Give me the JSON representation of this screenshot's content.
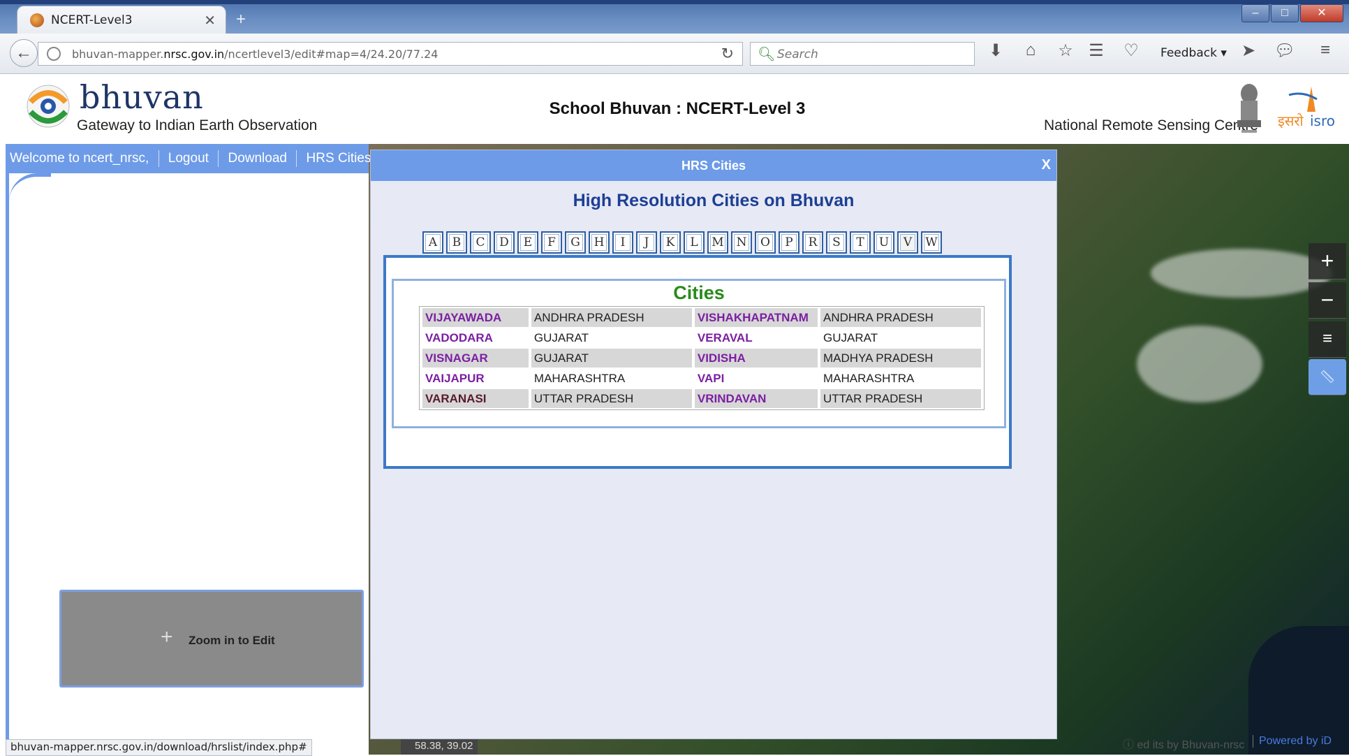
{
  "browser": {
    "tab_title": "NCERT-Level3",
    "tab_close": "✕",
    "new_tab": "+",
    "url_domain_prefix": "bhuvan-mapper.",
    "url_domain": "nrsc.gov.in",
    "url_path": "/ncertlevel3/edit#map=4/24.20/77.24",
    "search_placeholder": "Search",
    "feedback_label": "Feedback",
    "status_url": "bhuvan-mapper.nrsc.gov.in/download/hrslist/index.php#"
  },
  "header": {
    "logo_word": "bhuvan",
    "logo_tagline": "Gateway to Indian Earth Observation",
    "title": "School Bhuvan : NCERT-Level 3",
    "org": "National Remote Sensing Centre"
  },
  "menu": {
    "welcome": "Welcome to ncert_nrsc,",
    "logout": "Logout",
    "download": "Download",
    "hrs_cities": "HRS Cities"
  },
  "left_panel": {
    "zoom_label": "Zoom in to Edit"
  },
  "dialog": {
    "title": "HRS Cities",
    "close": "X",
    "heading": "High Resolution Cities on Bhuvan",
    "letters": [
      "A",
      "B",
      "C",
      "D",
      "E",
      "F",
      "G",
      "H",
      "I",
      "J",
      "K",
      "L",
      "M",
      "N",
      "O",
      "P",
      "R",
      "S",
      "T",
      "U",
      "V",
      "W"
    ],
    "selected_letter": "V",
    "cities_title": "Cities",
    "rows": [
      {
        "c1": "VIJAYAWADA",
        "s1": "ANDHRA PRADESH",
        "c2": "VISHAKHAPATNAM",
        "s2": "ANDHRA PRADESH"
      },
      {
        "c1": "VADODARA",
        "s1": "GUJARAT",
        "c2": "VERAVAL",
        "s2": "GUJARAT"
      },
      {
        "c1": "VISNAGAR",
        "s1": "GUJARAT",
        "c2": "VIDISHA",
        "s2": "MADHYA PRADESH"
      },
      {
        "c1": "VAIJAPUR",
        "s1": "MAHARASHTRA",
        "c2": "VAPI",
        "s2": "MAHARASHTRA"
      },
      {
        "c1": "VARANASI",
        "s1": "UTTAR PRADESH",
        "c2": "VRINDAVAN",
        "s2": "UTTAR PRADESH"
      }
    ]
  },
  "map": {
    "coords": "58.38, 39.02",
    "credits": "ed its by Bhuvan-nrsc",
    "powered_by": "Powered by iD"
  },
  "colors": {
    "accent_blue": "#6d9be8",
    "heading_blue": "#1c3f94",
    "cities_green": "#2a8a1c",
    "city_purple": "#7b1fa2"
  }
}
